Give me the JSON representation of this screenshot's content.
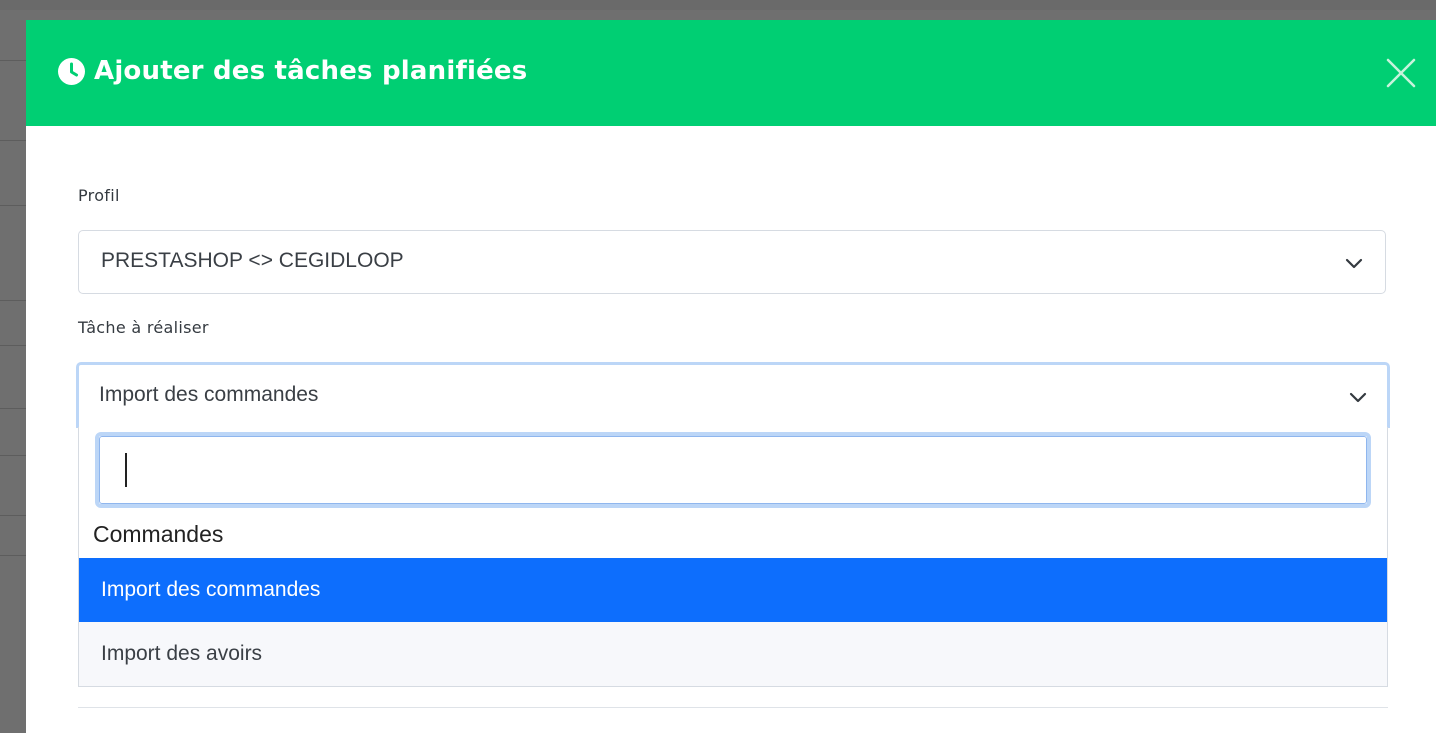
{
  "modal": {
    "title": "Ajouter des tâches planifiées",
    "header_color": "#00cf73",
    "close_icon": "close-icon",
    "title_icon": "clock-icon"
  },
  "form": {
    "profile": {
      "label": "Profil",
      "value": "PRESTASHOP <> CEGIDLOOP"
    },
    "task": {
      "label": "Tâche à réaliser",
      "value": "Import des commandes",
      "dropdown": {
        "search_value": "",
        "group_label": "Commandes",
        "options": [
          {
            "label": "Import des commandes",
            "selected": true
          },
          {
            "label": "Import des avoirs",
            "selected": false
          }
        ]
      }
    }
  },
  "colors": {
    "accent": "#00cf73",
    "selected_option": "#0d6efd",
    "focus_ring": "#bcd6f7"
  }
}
